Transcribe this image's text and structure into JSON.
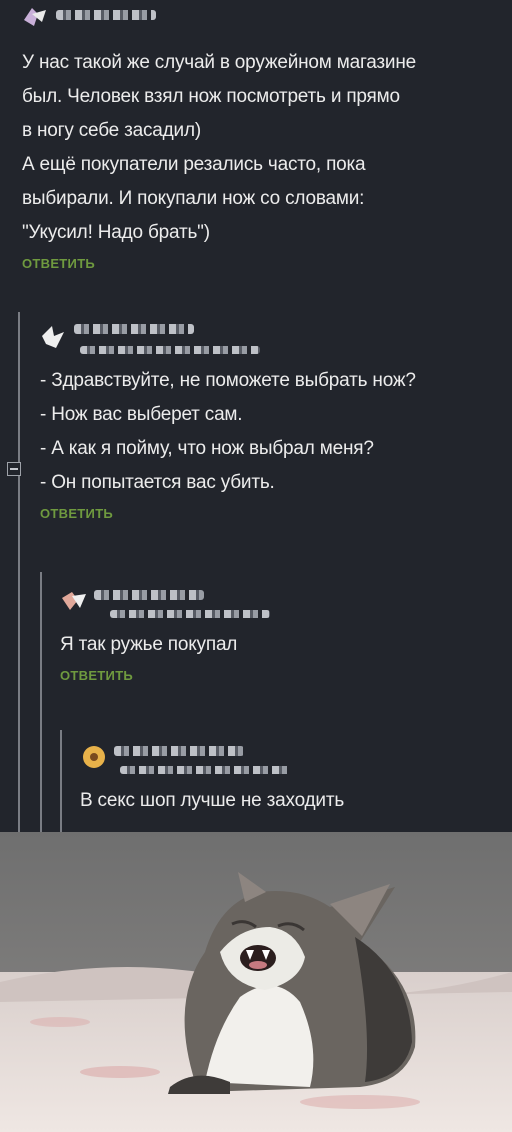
{
  "comments": [
    {
      "lines": [
        "У нас такой же случай в оружейном магазине",
        "был. Человек взял нож посмотреть и прямо",
        "в ногу себе засадил)",
        "А ещё покупатели резались часто, пока",
        "выбирали. И покупали нож со словами:",
        "\"Укусил! Надо брать\")"
      ],
      "reply_label": "ОТВЕТИТЬ"
    },
    {
      "lines": [
        "- Здравствуйте, не поможете выбрать нож?",
        "- Нож вас выберет сам.",
        "- А как я пойму, что нож выбрал меня?",
        "- Он попытается вас убить."
      ],
      "reply_label": "ОТВЕТИТЬ"
    },
    {
      "lines": [
        "Я так ружье покупал"
      ],
      "reply_label": "ОТВЕТИТЬ"
    },
    {
      "lines": [
        "В секс шоп лучше не заходить"
      ]
    }
  ],
  "colors": {
    "background": "#22252c",
    "text": "#ececec",
    "reply_link": "#6f9a3f",
    "thread_line": "#7a7d84"
  },
  "icons": [
    "collapse-thread-icon",
    "avatar-icon",
    "cat-photo"
  ]
}
